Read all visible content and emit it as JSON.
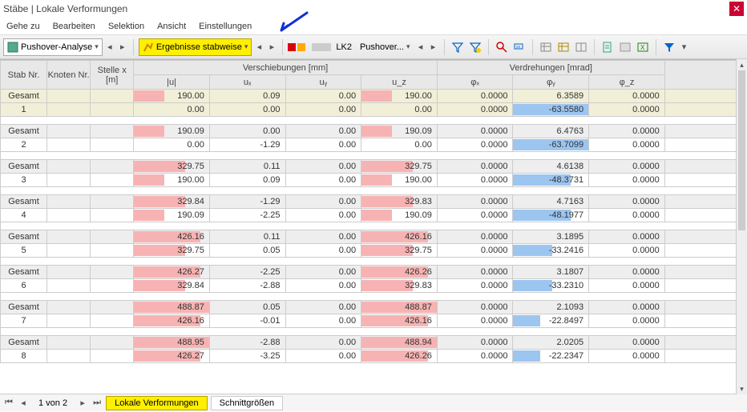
{
  "window": {
    "title": "Stäbe | Lokale Verformungen"
  },
  "menu": [
    "Gehe zu",
    "Bearbeiten",
    "Selektion",
    "Ansicht",
    "Einstellungen"
  ],
  "toolbar": {
    "analysis_combo": "Pushover-Analyse",
    "results_combo": "Ergebnisse stabweise",
    "loadcase_combo_a": "LK2",
    "loadcase_combo_b": "Pushover..."
  },
  "grid": {
    "groups": {
      "g1": "Verschiebungen [mm]",
      "g2": "Verdrehungen [mrad]"
    },
    "cols": {
      "c0": "Stab\nNr.",
      "c1": "Knoten\nNr.",
      "c2": "Stelle\nx [m]",
      "c3": "|u|",
      "c4": "uₓ",
      "c5": "uᵧ",
      "c6": "u_z",
      "c7": "φₓ",
      "c8": "φᵧ",
      "c9": "φ_z"
    },
    "rows": [
      {
        "lbl": "Gesamt",
        "u": 190.0,
        "ux": 0.09,
        "uy": 0.0,
        "uz": 190.0,
        "px": 0.0,
        "py": 6.3589,
        "pz": 0.0,
        "tint": true,
        "bu": 40,
        "buz": 40
      },
      {
        "lbl": "1",
        "u": 0.0,
        "ux": 0.0,
        "uy": 0.0,
        "uz": 0.0,
        "px": 0.0,
        "py": -63.558,
        "pz": 0.0,
        "idx": true,
        "bpy": 100
      },
      {
        "spacer": true
      },
      {
        "lbl": "Gesamt",
        "u": 190.09,
        "ux": 0.0,
        "uy": 0.0,
        "uz": 190.09,
        "px": 0.0,
        "py": 6.4763,
        "pz": 0.0,
        "bu": 40,
        "buz": 40
      },
      {
        "lbl": "2",
        "u": 0.0,
        "ux": -1.29,
        "uy": 0.0,
        "uz": 0.0,
        "px": 0.0,
        "py": -63.7099,
        "pz": 0.0,
        "bpy": 100
      },
      {
        "spacer": true
      },
      {
        "lbl": "Gesamt",
        "u": 329.75,
        "ux": 0.11,
        "uy": 0.0,
        "uz": 329.75,
        "px": 0.0,
        "py": 4.6138,
        "pz": 0.0,
        "bu": 68,
        "buz": 68
      },
      {
        "lbl": "3",
        "u": 190.0,
        "ux": 0.09,
        "uy": 0.0,
        "uz": 190.0,
        "px": 0.0,
        "py": -48.3731,
        "pz": 0.0,
        "bu": 40,
        "buz": 40,
        "bpy": 76
      },
      {
        "spacer": true
      },
      {
        "lbl": "Gesamt",
        "u": 329.84,
        "ux": -1.29,
        "uy": 0.0,
        "uz": 329.83,
        "px": 0.0,
        "py": 4.7163,
        "pz": 0.0,
        "bu": 68,
        "buz": 68
      },
      {
        "lbl": "4",
        "u": 190.09,
        "ux": -2.25,
        "uy": 0.0,
        "uz": 190.09,
        "px": 0.0,
        "py": -48.1977,
        "pz": 0.0,
        "bu": 40,
        "buz": 40,
        "bpy": 76
      },
      {
        "spacer": true
      },
      {
        "lbl": "Gesamt",
        "u": 426.16,
        "ux": 0.11,
        "uy": 0.0,
        "uz": 426.16,
        "px": 0.0,
        "py": 3.1895,
        "pz": 0.0,
        "bu": 88,
        "buz": 88
      },
      {
        "lbl": "5",
        "u": 329.75,
        "ux": 0.05,
        "uy": 0.0,
        "uz": 329.75,
        "px": 0.0,
        "py": -33.2416,
        "pz": 0.0,
        "bu": 68,
        "buz": 68,
        "bpy": 52
      },
      {
        "spacer": true
      },
      {
        "lbl": "Gesamt",
        "u": 426.27,
        "ux": -2.25,
        "uy": 0.0,
        "uz": 426.26,
        "px": 0.0,
        "py": 3.1807,
        "pz": 0.0,
        "bu": 88,
        "buz": 88
      },
      {
        "lbl": "6",
        "u": 329.84,
        "ux": -2.88,
        "uy": 0.0,
        "uz": 329.83,
        "px": 0.0,
        "py": -33.231,
        "pz": 0.0,
        "bu": 68,
        "buz": 68,
        "bpy": 52
      },
      {
        "spacer": true
      },
      {
        "lbl": "Gesamt",
        "u": 488.87,
        "ux": 0.05,
        "uy": 0.0,
        "uz": 488.87,
        "px": 0.0,
        "py": 2.1093,
        "pz": 0.0,
        "bu": 100,
        "buz": 100
      },
      {
        "lbl": "7",
        "u": 426.16,
        "ux": -0.01,
        "uy": 0.0,
        "uz": 426.16,
        "px": 0.0,
        "py": -22.8497,
        "pz": 0.0,
        "bu": 88,
        "buz": 88,
        "bpy": 36
      },
      {
        "spacer": true
      },
      {
        "lbl": "Gesamt",
        "u": 488.95,
        "ux": -2.88,
        "uy": 0.0,
        "uz": 488.94,
        "px": 0.0,
        "py": 2.0205,
        "pz": 0.0,
        "bu": 100,
        "buz": 100
      },
      {
        "lbl": "8",
        "u": 426.27,
        "ux": -3.25,
        "uy": 0.0,
        "uz": 426.26,
        "px": 0.0,
        "py": -22.2347,
        "pz": 0.0,
        "bu": 88,
        "buz": 88,
        "bpy": 36
      }
    ]
  },
  "pager": {
    "label": "1 von 2",
    "tab_active": "Lokale Verformungen",
    "tab_2": "Schnittgrößen"
  }
}
